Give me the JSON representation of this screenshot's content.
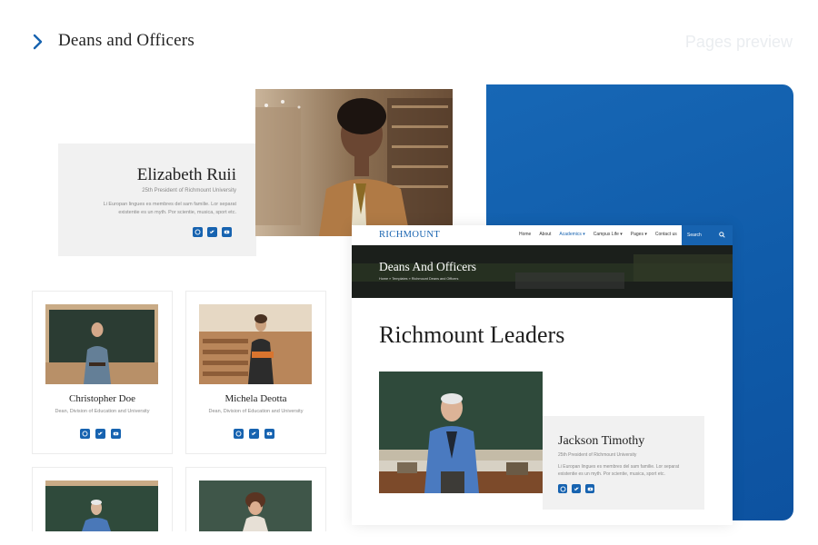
{
  "header": {
    "title": "Deans and Officers",
    "preview_label": "Pages preview"
  },
  "featured": {
    "name": "Elizabeth Ruii",
    "role": "25th President of Richmount University",
    "description": "Li Europan lingues es membres del sam familie. Lor separat existentie es un myth. Por scientie, musica, sport etc."
  },
  "staff": [
    {
      "name": "Christopher Doe",
      "role": "Dean, Division of Education and University"
    },
    {
      "name": "Michela Deotta",
      "role": "Dean, Division of Education and University"
    }
  ],
  "site": {
    "logo": "RICHMOUNT",
    "nav": [
      "Home",
      "About",
      "Academics",
      "Campus Life",
      "Pages",
      "Contact us"
    ],
    "active_nav": "Academics",
    "search_label": "Search",
    "hero_title": "Deans And Officers",
    "breadcrumb": "Home » Templates » Richmount Deans and Officers",
    "section_title": "Richmount Leaders",
    "leader": {
      "name": "Jackson Timothy",
      "role": "25th President of Richmount University",
      "description": "Li Europan lingues es membres del sam familie. Lor separat existentie es un myth. Por scientie, musica, sport etc."
    }
  },
  "socials": [
    "facebook-icon",
    "twitter-icon",
    "youtube-icon"
  ],
  "colors": {
    "accent": "#1763b0",
    "blue_panel": "#0f5aa8",
    "card_bg": "#f1f1f1"
  }
}
